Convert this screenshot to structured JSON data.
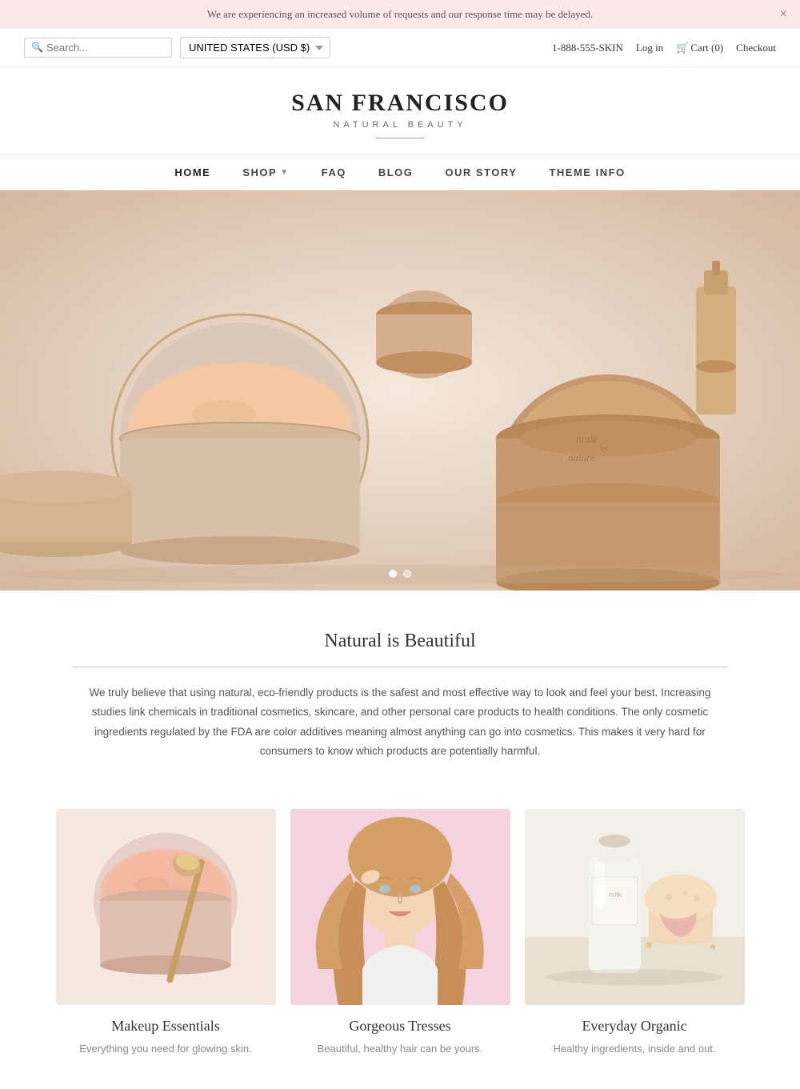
{
  "announcement": {
    "text": "We are experiencing an increased volume of requests and our response time may be delayed.",
    "close_label": "×"
  },
  "topbar": {
    "search_placeholder": "Search...",
    "country_label": "UNITED STATES (USD $)",
    "phone": "1-888-555-SKIN",
    "login_label": "Log in",
    "cart_label": "Cart (0)",
    "checkout_label": "Checkout"
  },
  "header": {
    "brand_name": "SAN FRANCISCO",
    "brand_subtitle": "NATURAL BEAUTY"
  },
  "nav": {
    "items": [
      {
        "label": "HOME",
        "active": true,
        "has_dropdown": false
      },
      {
        "label": "SHOP",
        "active": false,
        "has_dropdown": true
      },
      {
        "label": "FAQ",
        "active": false,
        "has_dropdown": false
      },
      {
        "label": "BLOG",
        "active": false,
        "has_dropdown": false
      },
      {
        "label": "OUR STORY",
        "active": false,
        "has_dropdown": false
      },
      {
        "label": "THEME INFO",
        "active": false,
        "has_dropdown": false
      }
    ]
  },
  "hero": {
    "slide_count": 2,
    "active_dot": 0
  },
  "section_natural": {
    "title": "Natural is Beautiful",
    "body": "We truly believe that using natural, eco-friendly products is the safest and most effective way to look and feel your best. Increasing studies link chemicals in traditional cosmetics, skincare, and other personal care products to health conditions. The only cosmetic ingredients regulated by the FDA are color additives meaning almost anything can go into cosmetics. This makes it very hard for consumers to know which products are potentially harmful."
  },
  "product_cards": [
    {
      "title": "Makeup Essentials",
      "description": "Everything you need for glowing skin."
    },
    {
      "title": "Gorgeous Tresses",
      "description": "Beautiful, healthy hair can be yours."
    },
    {
      "title": "Everyday Organic",
      "description": "Healthy ingredients, inside and out."
    }
  ]
}
